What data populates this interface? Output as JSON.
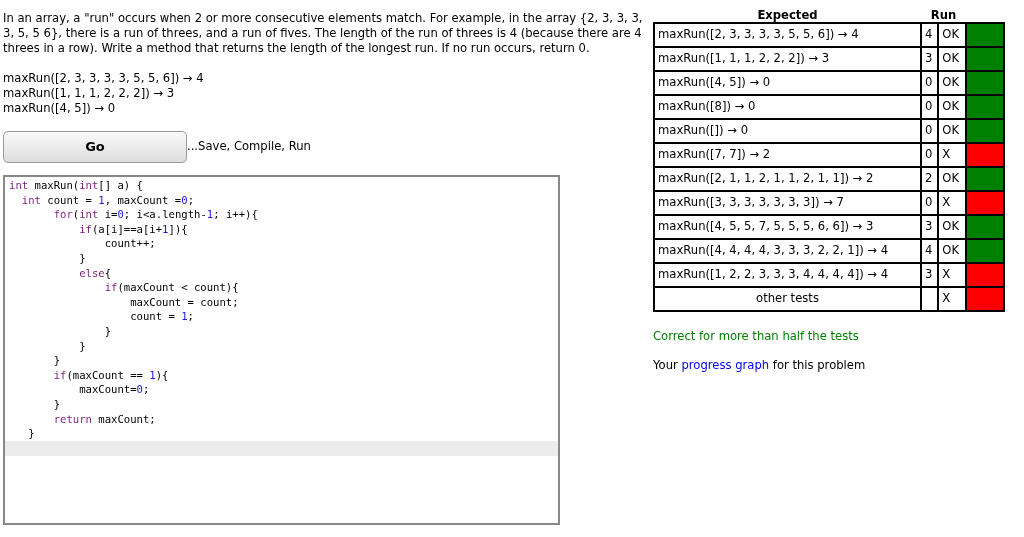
{
  "problem": {
    "description": "In an array, a \"run\" occurs when 2 or more consecutive elements match. For example, in the array {2, 3, 3, 3, 3, 5, 5 6}, there is a run of threes, and a run of fives. The length of the run of threes is 4 (because there are 4 threes in a row). Write a method that returns the length of the longest run. If no run occurs, return 0.",
    "examples": [
      "maxRun([2, 3, 3, 3, 3, 5, 5, 6]) → 4",
      "maxRun([1, 1, 1, 2, 2, 2]) → 3",
      "maxRun([4, 5]) → 0"
    ]
  },
  "go_button": {
    "label": "Go",
    "hint": "...Save, Compile, Run"
  },
  "editor": {
    "lines": [
      "int maxRun(int[] a) {",
      "  int count = 1, maxCount =0;",
      "       for(int i=0; i<a.length-1; i++){",
      "           if(a[i]==a[i+1]){",
      "               count++;",
      "           }",
      "           else{",
      "               if(maxCount < count){",
      "                   maxCount = count;",
      "                   count = 1;",
      "               }",
      "           }",
      "       }",
      "       if(maxCount == 1){",
      "           maxCount=0;",
      "       }",
      "       return maxCount;",
      "   }"
    ]
  },
  "results": {
    "columns": [
      "Expected",
      "Run"
    ],
    "rows": [
      {
        "kind": "test",
        "expected": "maxRun([2, 3, 3, 3, 3, 5, 5, 6]) → 4",
        "run": "4",
        "verdict": "OK",
        "passed": true
      },
      {
        "kind": "test",
        "expected": "maxRun([1, 1, 1, 2, 2, 2]) → 3",
        "run": "3",
        "verdict": "OK",
        "passed": true
      },
      {
        "kind": "test",
        "expected": "maxRun([4, 5]) → 0",
        "run": "0",
        "verdict": "OK",
        "passed": true
      },
      {
        "kind": "test",
        "expected": "maxRun([8]) → 0",
        "run": "0",
        "verdict": "OK",
        "passed": true
      },
      {
        "kind": "test",
        "expected": "maxRun([]) → 0",
        "run": "0",
        "verdict": "OK",
        "passed": true
      },
      {
        "kind": "test",
        "expected": "maxRun([7, 7]) → 2",
        "run": "0",
        "verdict": "X",
        "passed": false
      },
      {
        "kind": "test",
        "expected": "maxRun([2, 1, 1, 2, 1, 1, 2, 1, 1]) → 2",
        "run": "2",
        "verdict": "OK",
        "passed": true
      },
      {
        "kind": "test",
        "expected": "maxRun([3, 3, 3, 3, 3, 3, 3]) → 7",
        "run": "0",
        "verdict": "X",
        "passed": false
      },
      {
        "kind": "test",
        "expected": "maxRun([4, 5, 5, 7, 5, 5, 5, 6, 6]) → 3",
        "run": "3",
        "verdict": "OK",
        "passed": true
      },
      {
        "kind": "test",
        "expected": "maxRun([4, 4, 4, 4, 3, 3, 3, 2, 2, 1]) → 4",
        "run": "4",
        "verdict": "OK",
        "passed": true
      },
      {
        "kind": "test",
        "expected": "maxRun([1, 2, 2, 3, 3, 3, 4, 4, 4, 4]) → 4",
        "run": "3",
        "verdict": "X",
        "passed": false
      },
      {
        "kind": "other",
        "expected": "other tests",
        "verdict": "X",
        "passed": false
      }
    ],
    "summary": "Correct for more than half the tests",
    "progress": {
      "before": "Your",
      "link": "progress graph",
      "after": "for this problem"
    }
  }
}
